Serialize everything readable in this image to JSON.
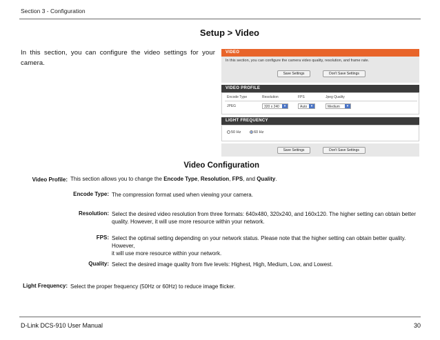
{
  "header": {
    "section": "Section 3 - Configuration"
  },
  "title": "Setup > Video",
  "intro": "In this section, you can configure the video settings for your camera.",
  "screenshot": {
    "video_header": "VIDEO",
    "video_desc": "In this section, you can configure the camera video quality, resolution, and frame rate.",
    "save_label": "Save Settings",
    "dont_save_label": "Don't Save Settings",
    "profile_header": "VIDEO PROFILE",
    "columns": [
      "Encode Type",
      "Resolution",
      "FPS",
      "Jpeg Quality"
    ],
    "encode_type": "JPEG",
    "resolution": "320 x 240",
    "fps": "Auto",
    "quality": "Medium",
    "light_header": "LIGHT FREQUENCY",
    "freq_50": "50 Hz",
    "freq_60": "60 Hz",
    "freq_selected": "60 Hz"
  },
  "config_title": "Video Configuration",
  "items": {
    "video_profile": {
      "label": "Video Profile:",
      "pre": "This section allows you to change the ",
      "b1": "Encode Type",
      "s1": ", ",
      "b2": "Resolution",
      "s2": ", ",
      "b3": "FPS",
      "s3": ", and ",
      "b4": "Quality",
      "post": "."
    },
    "encode_type": {
      "label": "Encode Type:",
      "text": "The compression format used when viewing your camera."
    },
    "resolution": {
      "label": "Resolution:",
      "line1": "Select the desired video resolution from three formats: 640x480, 320x240, and 160x120. The higher setting can obtain better",
      "line2": "quality. However, it will use more resource within your network."
    },
    "fps": {
      "label": "FPS:",
      "line1": "Select the optimal setting depending on your network status. Please note that the higher setting can obtain better quality. However,",
      "line2": "it will use more resource within your network."
    },
    "quality": {
      "label": "Quality:",
      "text": "Select the desired image quality from five levels: Highest, High, Medium, Low, and Lowest."
    },
    "light_frequency": {
      "label": "Light Frequency:",
      "text": "Select the proper frequency (50Hz or 60Hz) to reduce image flicker."
    }
  },
  "footer": {
    "manual": "D-Link DCS-910 User Manual",
    "page": "30"
  }
}
